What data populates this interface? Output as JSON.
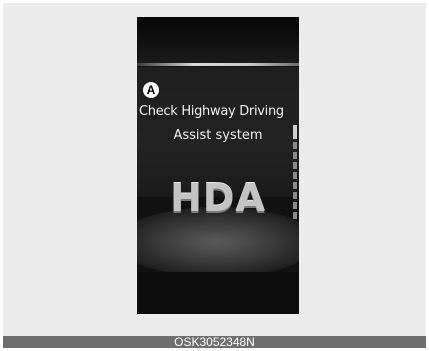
{
  "figure": {
    "callout_marker": "A",
    "warning_line1": "Check Highway Driving",
    "warning_line2": "Assist system",
    "feature_label": "HDA",
    "caption": "OSK3052348N"
  },
  "colors": {
    "background": "#ececec",
    "display": "#111111",
    "caption_bar": "#6e6e6e",
    "text": "#f0f0f0"
  }
}
